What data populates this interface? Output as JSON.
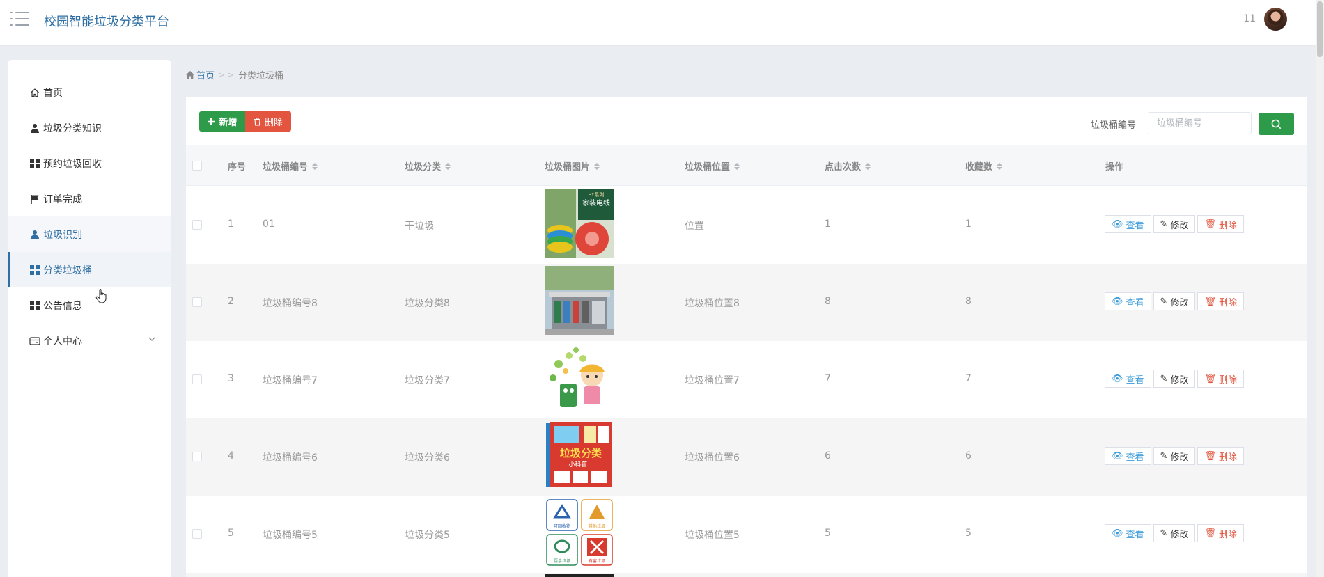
{
  "header": {
    "title": "校园智能垃圾分类平台",
    "user": "11"
  },
  "sidebar": {
    "items": [
      {
        "label": "首页",
        "icon": "home-icon"
      },
      {
        "label": "垃圾分类知识",
        "icon": "user-icon"
      },
      {
        "label": "预约垃圾回收",
        "icon": "grid-icon"
      },
      {
        "label": "订单完成",
        "icon": "flag-icon"
      },
      {
        "label": "垃圾识别",
        "icon": "user-icon"
      },
      {
        "label": "分类垃圾桶",
        "icon": "grid-icon"
      },
      {
        "label": "公告信息",
        "icon": "grid-icon"
      },
      {
        "label": "个人中心",
        "icon": "wallet-icon"
      }
    ]
  },
  "breadcrumb": {
    "home": "首页",
    "separator": "> >",
    "current": "分类垃圾桶"
  },
  "toolbar": {
    "add": "新增",
    "delete": "删除"
  },
  "search": {
    "label": "垃圾桶编号",
    "placeholder": "垃圾桶编号"
  },
  "table": {
    "columns": [
      "序号",
      "垃圾桶编号",
      "垃圾分类",
      "垃圾桶图片",
      "垃圾桶位置",
      "点击次数",
      "收藏数",
      "操作"
    ],
    "actions": {
      "view": "查看",
      "edit": "修改",
      "delete": "删除"
    },
    "rows": [
      {
        "index": "1",
        "code": "01",
        "category": "干垃圾",
        "image": "电线",
        "location": "位置",
        "clicks": "1",
        "favorites": "1"
      },
      {
        "index": "2",
        "code": "垃圾桶编号8",
        "category": "垃圾分类8",
        "image": "垃圾站",
        "location": "垃圾桶位置8",
        "clicks": "8",
        "favorites": "8"
      },
      {
        "index": "3",
        "code": "垃圾桶编号7",
        "category": "垃圾分类7",
        "image": "卡通",
        "location": "垃圾桶位置7",
        "clicks": "7",
        "favorites": "7"
      },
      {
        "index": "4",
        "code": "垃圾桶编号6",
        "category": "垃圾分类6",
        "image": "书",
        "location": "垃圾桶位置6",
        "clicks": "6",
        "favorites": "6"
      },
      {
        "index": "5",
        "code": "垃圾桶编号5",
        "category": "垃圾分类5",
        "image": "标志",
        "location": "垃圾桶位置5",
        "clicks": "5",
        "favorites": "5"
      }
    ]
  },
  "images": {
    "cable": {
      "line1": "BY系列",
      "line2": "家装电线"
    },
    "book": {
      "title": "垃圾分类",
      "subtitle": "小科普"
    },
    "signs": [
      "可回收物",
      "其他垃圾",
      "厨余垃圾",
      "有害垃圾"
    ]
  },
  "colors": {
    "primary": "#2f6fa3",
    "success": "#2e9b4a",
    "danger": "#e3553f",
    "info": "#3a9bd9"
  }
}
